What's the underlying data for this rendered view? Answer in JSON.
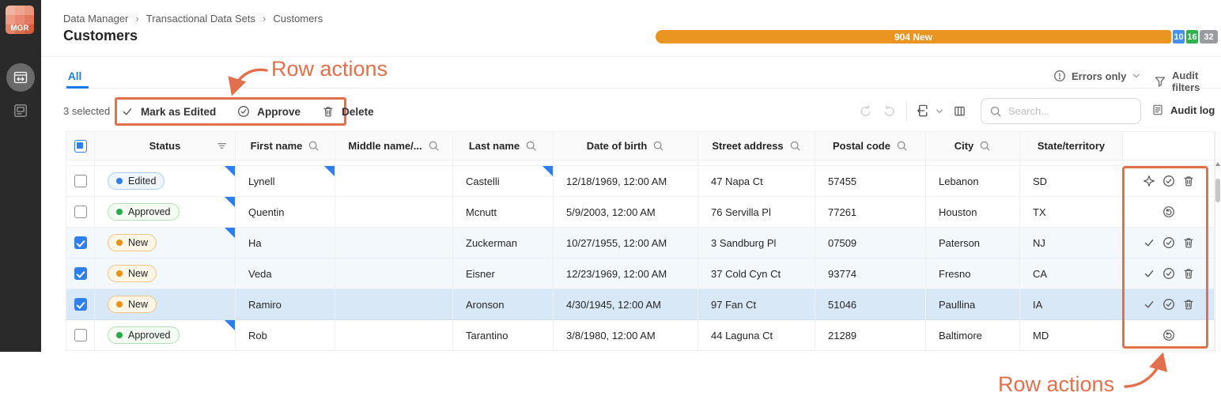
{
  "sidebar": {
    "logo_text": "MGR",
    "nav_items": [
      {
        "name": "data-sets",
        "active": true
      },
      {
        "name": "console",
        "active": false
      }
    ]
  },
  "header": {
    "breadcrumb": [
      "Data Manager",
      "Transactional Data Sets",
      "Customers"
    ],
    "separator": "›",
    "title": "Customers",
    "progress": {
      "main_label": "904 New",
      "main_color": "#ea9421",
      "segments": [
        {
          "label": "10",
          "color": "#4590f0"
        },
        {
          "label": "16",
          "color": "#2fb14d"
        },
        {
          "label": "32",
          "color": "#999b9e"
        }
      ]
    }
  },
  "tabs": {
    "all_label": "All"
  },
  "view_controls": {
    "errors_only_label": "Errors only",
    "audit_filters_label": "Audit filters"
  },
  "toolbar": {
    "selected_label": "3 selected",
    "mark_as_edited_label": "Mark as Edited",
    "approve_label": "Approve",
    "delete_label": "Delete",
    "search_placeholder": "Search...",
    "audit_log_label": "Audit log"
  },
  "annotation": {
    "top_label": "Row actions",
    "bottom_label": "Row actions",
    "color": "#e2704c"
  },
  "table": {
    "columns": [
      "Status",
      "First name",
      "Middle name/...",
      "Last name",
      "Date of birth",
      "Street address",
      "Postal code",
      "City",
      "State/territory"
    ],
    "rows": [
      {
        "status": "Edited",
        "status_type": "edited",
        "first": "Lynell",
        "middle": "",
        "last": "Castelli",
        "dob": "12/18/1969, 12:00 AM",
        "street": "47 Napa Ct",
        "postal": "57455",
        "city": "Lebanon",
        "state": "SD",
        "selected": false,
        "dirty_cells": [
          "status",
          "first_name",
          "last_name"
        ],
        "row_actions": [
          "mark-as-edited",
          "approve",
          "delete"
        ]
      },
      {
        "status": "Approved",
        "status_type": "approved",
        "first": "Quentin",
        "middle": "",
        "last": "Mcnutt",
        "dob": "5/9/2003, 12:00 AM",
        "street": "76 Servilla Pl",
        "postal": "77261",
        "city": "Houston",
        "state": "TX",
        "selected": false,
        "dirty_cells": [
          "status"
        ],
        "row_actions": [
          "revert"
        ]
      },
      {
        "status": "New",
        "status_type": "new",
        "first": "Ha",
        "middle": "",
        "last": "Zuckerman",
        "dob": "10/27/1955, 12:00 AM",
        "street": "3 Sandburg Pl",
        "postal": "07509",
        "city": "Paterson",
        "state": "NJ",
        "selected": true,
        "dirty_cells": [
          "status"
        ],
        "row_actions": [
          "mark-as-edited",
          "approve",
          "delete"
        ]
      },
      {
        "status": "New",
        "status_type": "new",
        "first": "Veda",
        "middle": "",
        "last": "Eisner",
        "dob": "12/23/1969, 12:00 AM",
        "street": "37 Cold Cyn Ct",
        "postal": "93774",
        "city": "Fresno",
        "state": "CA",
        "selected": true,
        "dirty_cells": [],
        "row_actions": [
          "mark-as-edited",
          "approve",
          "delete"
        ]
      },
      {
        "status": "New",
        "status_type": "new",
        "first": "Ramiro",
        "middle": "",
        "last": "Aronson",
        "dob": "4/30/1945, 12:00 AM",
        "street": "97 Fan Ct",
        "postal": "51046",
        "city": "Paullina",
        "state": "IA",
        "selected": true,
        "highlighted": true,
        "dirty_cells": [],
        "row_actions": [
          "mark-as-edited",
          "approve",
          "delete"
        ]
      },
      {
        "status": "Approved",
        "status_type": "approved",
        "first": "Rob",
        "middle": "",
        "last": "Tarantino",
        "dob": "3/8/1980, 12:00 AM",
        "street": "44 Laguna Ct",
        "postal": "21289",
        "city": "Baltimore",
        "state": "MD",
        "selected": false,
        "dirty_cells": [
          "status"
        ],
        "row_actions": [
          "revert"
        ]
      }
    ]
  }
}
